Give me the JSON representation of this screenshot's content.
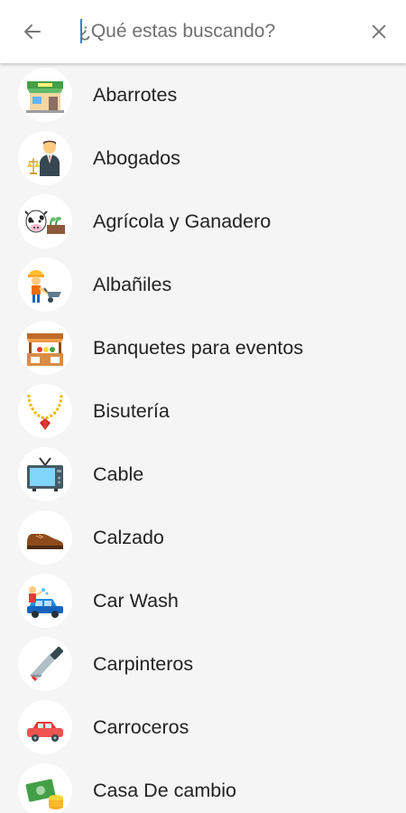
{
  "search": {
    "placeholder": "¿Qué estas buscando?"
  },
  "categories": [
    {
      "label": "Abarrotes",
      "icon": "grocery-store-icon"
    },
    {
      "label": "Abogados",
      "icon": "lawyer-icon"
    },
    {
      "label": "Agrícola y Ganadero",
      "icon": "cow-farm-icon"
    },
    {
      "label": "Albañiles",
      "icon": "construction-worker-icon"
    },
    {
      "label": "Banquetes para eventos",
      "icon": "banquet-stand-icon"
    },
    {
      "label": "Bisutería",
      "icon": "necklace-icon"
    },
    {
      "label": "Cable",
      "icon": "tv-icon"
    },
    {
      "label": "Calzado",
      "icon": "shoe-icon"
    },
    {
      "label": "Car Wash",
      "icon": "car-wash-icon"
    },
    {
      "label": "Carpinteros",
      "icon": "saw-icon"
    },
    {
      "label": "Carroceros",
      "icon": "red-car-icon"
    },
    {
      "label": "Casa De cambio",
      "icon": "money-exchange-icon"
    }
  ]
}
